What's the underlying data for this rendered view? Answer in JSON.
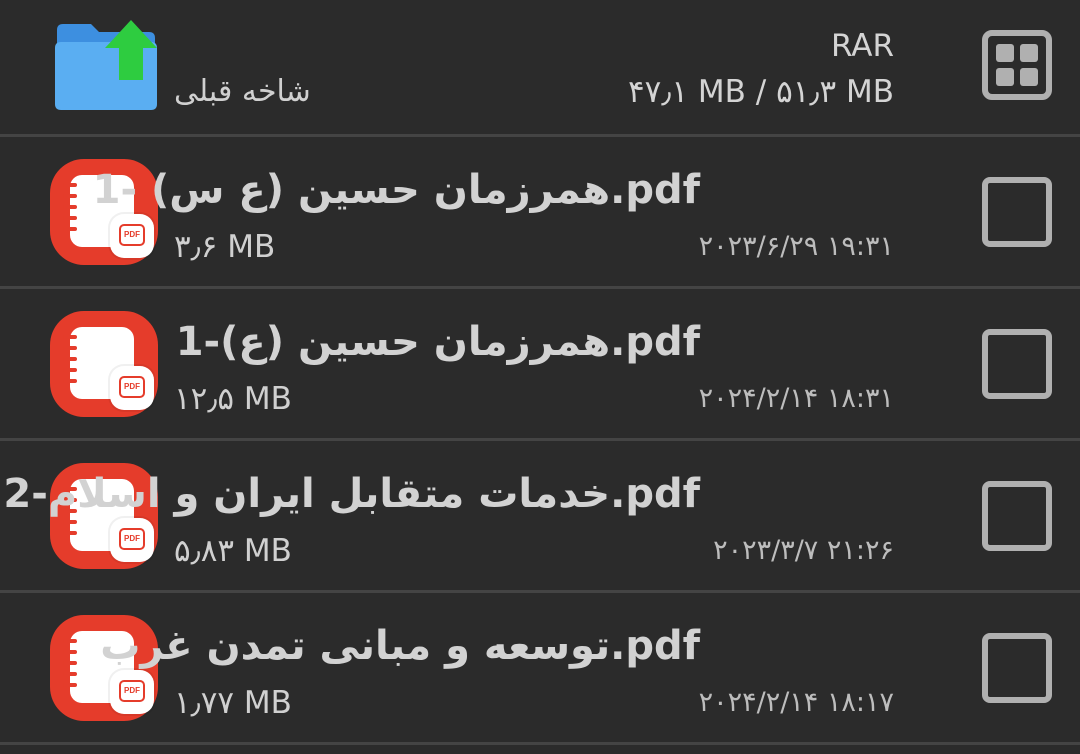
{
  "header": {
    "up_label": "شاخه قبلی",
    "archive_type": "RAR",
    "archive_size": "۴۷٫۱ MB / ۵۱٫۳ MB",
    "folder_icon": "folder-up-icon",
    "toggle_icon": "grid-view-icon"
  },
  "files": [
    {
      "name": "همرزمان حسین (ع س) -1.pdf",
      "size": "۳٫۶ MB",
      "date": "۲۰۲۳/۶/۲۹ ۱۹:۳۱",
      "icon": "pdf-file-icon",
      "badge": "PDF",
      "checked": false
    },
    {
      "name": "همرزمان حسین (ع)-1.pdf",
      "size": "۱۲٫۵ MB",
      "date": "۲۰۲۴/۲/۱۴ ۱۸:۳۱",
      "icon": "pdf-file-icon",
      "badge": "PDF",
      "checked": false
    },
    {
      "name": "خدمات متقابل ایران و اسلام-2.pdf",
      "size": "۵٫۸۳ MB",
      "date": "۲۰۲۳/۳/۷ ۲۱:۲۶",
      "icon": "pdf-file-icon",
      "badge": "PDF",
      "checked": false
    },
    {
      "name": "توسعه و مبانی تمدن غرب.pdf",
      "size": "۱٫۷۷ MB",
      "date": "۲۰۲۴/۲/۱۴ ۱۸:۱۷",
      "icon": "pdf-file-icon",
      "badge": "PDF",
      "checked": false
    }
  ],
  "colors": {
    "background": "#2b2b2b",
    "divider": "#444444",
    "pdf_red": "#e53c2b",
    "folder_blue": "#4aa8f0",
    "arrow_green": "#2ecc40"
  }
}
